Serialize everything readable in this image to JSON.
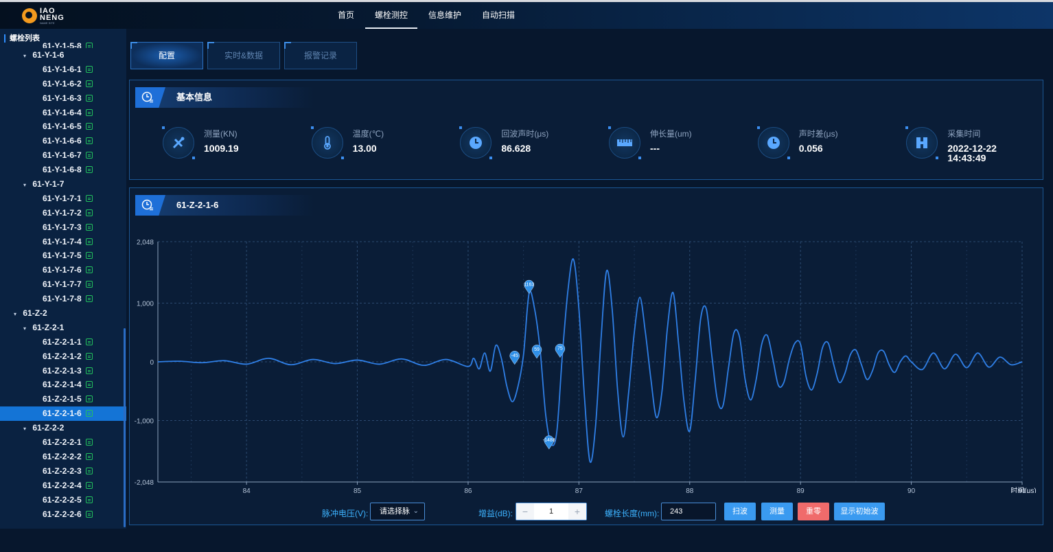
{
  "brand": {
    "logo_line1": "IAO",
    "logo_line2": "NENG",
    "logo_sub": "NAME SITE"
  },
  "nav": [
    {
      "label": "首页",
      "active": false
    },
    {
      "label": "螺栓测控",
      "active": true
    },
    {
      "label": "信息维护",
      "active": false
    },
    {
      "label": "自动扫描",
      "active": false
    }
  ],
  "sidebar": {
    "title": "螺栓列表",
    "items": [
      {
        "label": "61-Y-1-5-8",
        "level": 2,
        "leaf": true,
        "partial": true
      },
      {
        "label": "61-Y-1-6",
        "level": 1,
        "leaf": false
      },
      {
        "label": "61-Y-1-6-1",
        "level": 2,
        "leaf": true
      },
      {
        "label": "61-Y-1-6-2",
        "level": 2,
        "leaf": true
      },
      {
        "label": "61-Y-1-6-3",
        "level": 2,
        "leaf": true
      },
      {
        "label": "61-Y-1-6-4",
        "level": 2,
        "leaf": true
      },
      {
        "label": "61-Y-1-6-5",
        "level": 2,
        "leaf": true
      },
      {
        "label": "61-Y-1-6-6",
        "level": 2,
        "leaf": true
      },
      {
        "label": "61-Y-1-6-7",
        "level": 2,
        "leaf": true
      },
      {
        "label": "61-Y-1-6-8",
        "level": 2,
        "leaf": true
      },
      {
        "label": "61-Y-1-7",
        "level": 1,
        "leaf": false
      },
      {
        "label": "61-Y-1-7-1",
        "level": 2,
        "leaf": true
      },
      {
        "label": "61-Y-1-7-2",
        "level": 2,
        "leaf": true
      },
      {
        "label": "61-Y-1-7-3",
        "level": 2,
        "leaf": true
      },
      {
        "label": "61-Y-1-7-4",
        "level": 2,
        "leaf": true
      },
      {
        "label": "61-Y-1-7-5",
        "level": 2,
        "leaf": true
      },
      {
        "label": "61-Y-1-7-6",
        "level": 2,
        "leaf": true
      },
      {
        "label": "61-Y-1-7-7",
        "level": 2,
        "leaf": true
      },
      {
        "label": "61-Y-1-7-8",
        "level": 2,
        "leaf": true
      },
      {
        "label": "61-Z-2",
        "level": 0,
        "leaf": false
      },
      {
        "label": "61-Z-2-1",
        "level": 1,
        "leaf": false
      },
      {
        "label": "61-Z-2-1-1",
        "level": 2,
        "leaf": true
      },
      {
        "label": "61-Z-2-1-2",
        "level": 2,
        "leaf": true
      },
      {
        "label": "61-Z-2-1-3",
        "level": 2,
        "leaf": true
      },
      {
        "label": "61-Z-2-1-4",
        "level": 2,
        "leaf": true
      },
      {
        "label": "61-Z-2-1-5",
        "level": 2,
        "leaf": true
      },
      {
        "label": "61-Z-2-1-6",
        "level": 2,
        "leaf": true,
        "selected": true
      },
      {
        "label": "61-Z-2-2",
        "level": 1,
        "leaf": false
      },
      {
        "label": "61-Z-2-2-1",
        "level": 2,
        "leaf": true
      },
      {
        "label": "61-Z-2-2-2",
        "level": 2,
        "leaf": true
      },
      {
        "label": "61-Z-2-2-3",
        "level": 2,
        "leaf": true
      },
      {
        "label": "61-Z-2-2-4",
        "level": 2,
        "leaf": true
      },
      {
        "label": "61-Z-2-2-5",
        "level": 2,
        "leaf": true
      },
      {
        "label": "61-Z-2-2-6",
        "level": 2,
        "leaf": true
      }
    ]
  },
  "tabs": [
    {
      "label": "配置",
      "active": true
    },
    {
      "label": "实时&数据",
      "active": false
    },
    {
      "label": "报警记录",
      "active": false
    }
  ],
  "basic_info": {
    "title": "基本信息",
    "items": [
      {
        "icon": "wrench-pencil-icon",
        "label": "测量(KN)",
        "value": "1009.19"
      },
      {
        "icon": "thermometer-icon",
        "label": "温度(℃)",
        "value": "13.00"
      },
      {
        "icon": "clock-icon",
        "label": "回波声时(μs)",
        "value": "86.628"
      },
      {
        "icon": "ruler-icon",
        "label": "伸长量(um)",
        "value": "---"
      },
      {
        "icon": "clock-icon",
        "label": "声时差(μs)",
        "value": "0.056"
      },
      {
        "icon": "calendar-icon",
        "label": "采集时间",
        "value": "2022-12-22 14:43:49"
      }
    ]
  },
  "waveform": {
    "title": "61-Z-2-1-6"
  },
  "chart_data": {
    "type": "line",
    "title": "",
    "xlabel": "时间(μs)",
    "ylabel": "",
    "xlim": [
      83.2,
      91.0
    ],
    "ylim": [
      -2048,
      2048
    ],
    "x_ticks": [
      84,
      85,
      86,
      87,
      88,
      89,
      90,
      91
    ],
    "x_tick_labels": [
      "84",
      "85",
      "86",
      "87",
      "88",
      "89",
      "90",
      "91"
    ],
    "y_ticks": [
      -2048,
      -1000,
      0,
      1000,
      2048
    ],
    "y_tick_labels": [
      "-2,048",
      "-1,000",
      "0",
      "1,000",
      "2,048"
    ],
    "grid": true,
    "color": "#2f7fe6",
    "series": [
      {
        "x": [
          83.2,
          83.4,
          83.6,
          83.8,
          84.0,
          84.2,
          84.4,
          84.6,
          84.8,
          85.0,
          85.2,
          85.4,
          85.6,
          85.8,
          86.0,
          86.05,
          86.1,
          86.15,
          86.2,
          86.25,
          86.3,
          86.35,
          86.4,
          86.45,
          86.5,
          86.55,
          86.6,
          86.65,
          86.7,
          86.75,
          86.8,
          86.85,
          86.9,
          86.95,
          87.0,
          87.05,
          87.1,
          87.15,
          87.2,
          87.25,
          87.3,
          87.35,
          87.4,
          87.45,
          87.5,
          87.55,
          87.6,
          87.65,
          87.7,
          87.75,
          87.8,
          87.85,
          87.9,
          87.95,
          88.0,
          88.05,
          88.1,
          88.15,
          88.2,
          88.25,
          88.3,
          88.35,
          88.4,
          88.45,
          88.5,
          88.55,
          88.6,
          88.65,
          88.7,
          88.75,
          88.8,
          88.85,
          88.9,
          88.95,
          89.0,
          89.05,
          89.1,
          89.15,
          89.2,
          89.25,
          89.3,
          89.35,
          89.4,
          89.45,
          89.5,
          89.55,
          89.6,
          89.65,
          89.7,
          89.75,
          89.8,
          89.85,
          89.9,
          89.95,
          90.0,
          90.1,
          90.2,
          90.3,
          90.4,
          90.5,
          90.6,
          90.7,
          90.8,
          90.9,
          91.0
        ],
        "y": [
          0,
          10,
          -15,
          20,
          -40,
          60,
          -50,
          40,
          -30,
          30,
          -40,
          50,
          -60,
          40,
          -80,
          60,
          -120,
          150,
          -160,
          280,
          60,
          -420,
          -680,
          -420,
          120,
          1163,
          900,
          200,
          -900,
          -1400,
          -1200,
          100,
          1200,
          1750,
          900,
          -600,
          -1700,
          -1100,
          400,
          1550,
          900,
          -500,
          -1280,
          -500,
          500,
          1100,
          500,
          -300,
          -950,
          -500,
          600,
          1180,
          300,
          -700,
          -1180,
          -300,
          750,
          900,
          100,
          -650,
          -750,
          -100,
          500,
          420,
          -300,
          -650,
          -300,
          300,
          450,
          50,
          -400,
          -350,
          50,
          320,
          300,
          -250,
          -480,
          -200,
          250,
          320,
          -50,
          -350,
          -200,
          120,
          200,
          -50,
          -300,
          -150,
          150,
          180,
          -50,
          -180,
          0,
          100,
          0,
          -130,
          150,
          -120,
          130,
          -100,
          150,
          -90,
          80,
          -50,
          0
        ]
      }
    ],
    "markers": [
      {
        "x": 86.42,
        "y": -45,
        "label": "-45"
      },
      {
        "x": 86.55,
        "y": 1163,
        "label": "1163"
      },
      {
        "x": 86.62,
        "y": 59,
        "label": "59"
      },
      {
        "x": 86.73,
        "y": -1488,
        "label": "-1488"
      },
      {
        "x": 86.83,
        "y": 75,
        "label": "75"
      }
    ]
  },
  "controls": {
    "voltage_label": "脉冲电压(V):",
    "voltage_select": "请选择脉",
    "gain_label": "增益(dB):",
    "gain_value": "1",
    "gain_minus": "−",
    "gain_plus": "+",
    "length_label": "螺栓长度(mm):",
    "length_value": "243",
    "scan_btn": "扫波",
    "measure_btn": "测量",
    "reset_btn": "重零",
    "show_initial_btn": "显示初始波"
  },
  "colors": {
    "accent": "#2f7fe6",
    "selected": "#1474d6",
    "btn_primary": "#3a9af0",
    "btn_danger": "#f06b6b",
    "label_blue": "#3db3ff",
    "leaf_icon": "#23c45e"
  }
}
